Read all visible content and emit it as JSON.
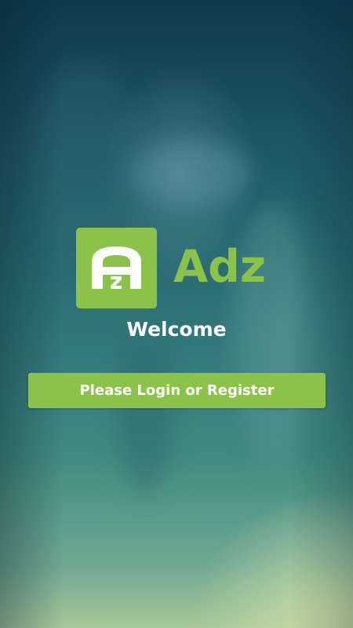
{
  "app": {
    "name": "Adz",
    "logo_icon": "adz-logo-icon",
    "logo_monogram": "AZ"
  },
  "screen": {
    "welcome_text": "Welcome",
    "login_button_label": "Please Login or Register"
  },
  "colors": {
    "accent": "#8bc34a",
    "text": "#ffffff",
    "background_top": "#0e3a4c",
    "background_bottom": "#a9c79a"
  }
}
